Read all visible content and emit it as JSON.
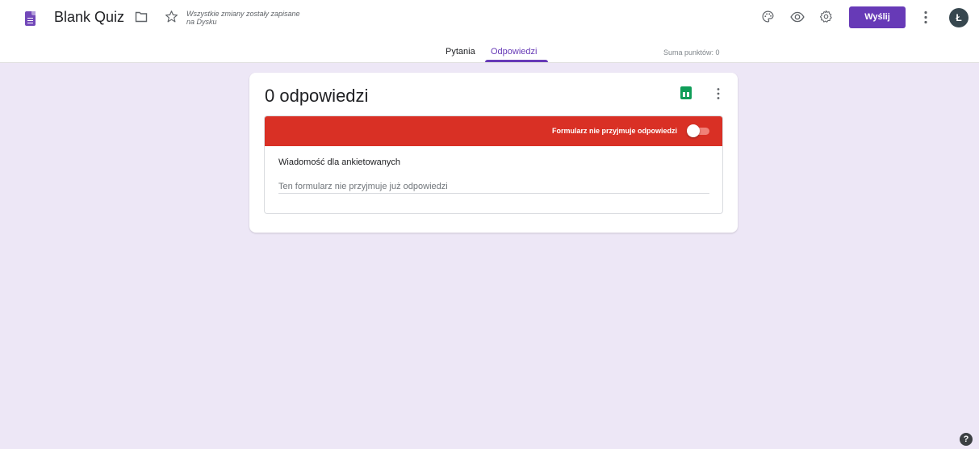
{
  "header": {
    "title": "Blank Quiz",
    "save_status": "Wszystkie zmiany zostały zapisane na Dysku",
    "send_label": "Wyślij",
    "avatar_initial": "Ł",
    "icons": [
      "forms-logo-icon",
      "folder-icon",
      "star-icon",
      "palette-icon",
      "eye-icon",
      "gear-icon",
      "more-vert-icon"
    ]
  },
  "tabs": [
    {
      "label": "Pytania",
      "active": false
    },
    {
      "label": "Odpowiedzi",
      "active": true
    }
  ],
  "points_total": "Suma punktów: 0",
  "responses": {
    "count_title": "0 odpowiedzi",
    "accepting_label": "Formularz nie przyjmuje odpowiedzi",
    "accepting_responses": false,
    "message_label": "Wiadomość dla ankietowanych",
    "message_value": "Ten formularz nie przyjmuje już odpowiedzi"
  },
  "help_label": "?",
  "colors": {
    "accent": "#673ab7",
    "background": "#ede7f6",
    "banner": "#d93025",
    "sheets": "#0f9d58"
  }
}
